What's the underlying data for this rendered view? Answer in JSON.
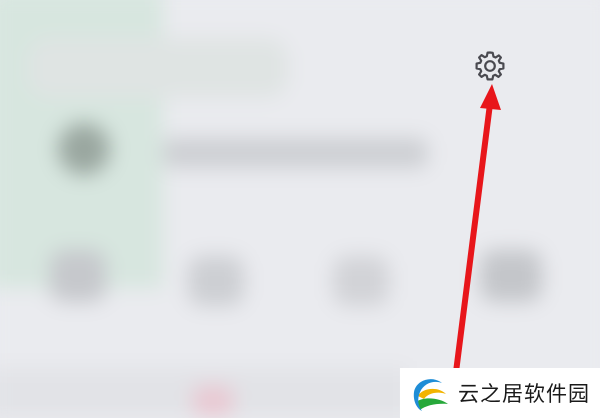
{
  "settings_icon": {
    "icon": "gear-icon",
    "color": "#4a4a50"
  },
  "annotation_arrow": {
    "color": "#e8161b",
    "points_to": "gear-icon"
  },
  "watermark": {
    "text": "云之居软件园",
    "logo_icon": "swirl-logo-icon",
    "colors": [
      "#1f8dd6",
      "#f2b400",
      "#27a83a"
    ]
  }
}
